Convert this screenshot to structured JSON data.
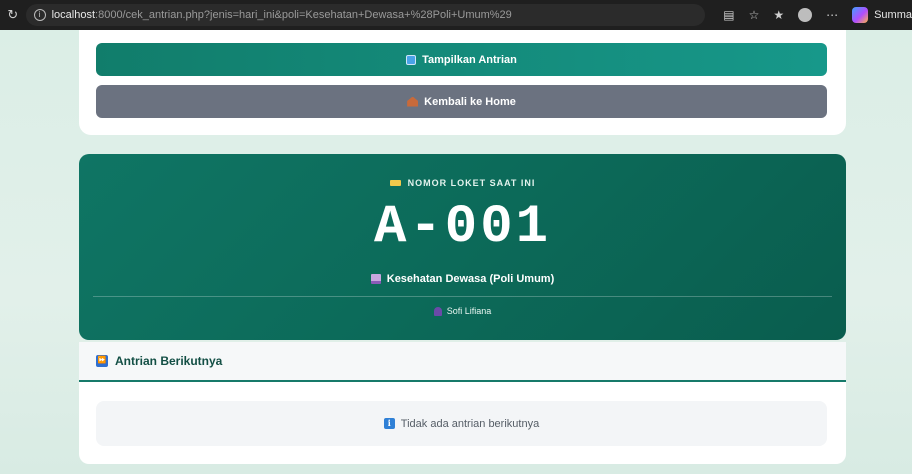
{
  "browser": {
    "url_host": "localhost",
    "url_rest": ":8000/cek_antrian.php?jenis=hari_ini&poli=Kesehatan+Dewasa+%28Poli+Umum%29",
    "summarize_label": "Summa"
  },
  "actions": {
    "show_queue_label": "Tampilkan Antrian",
    "back_home_label": "Kembali ke Home"
  },
  "loket": {
    "label": "NOMOR LOKET SAAT INI",
    "number": "A-001",
    "poli": "Kesehatan Dewasa (Poli Umum)",
    "staff": "Sofi Lifiana"
  },
  "next_queue": {
    "title": "Antrian Berikutnya",
    "empty_message": "Tidak ada antrian berikutnya"
  },
  "colors": {
    "primary": "#117d6b",
    "secondary": "#6b7280",
    "loket_bg": "#0c6a59"
  }
}
